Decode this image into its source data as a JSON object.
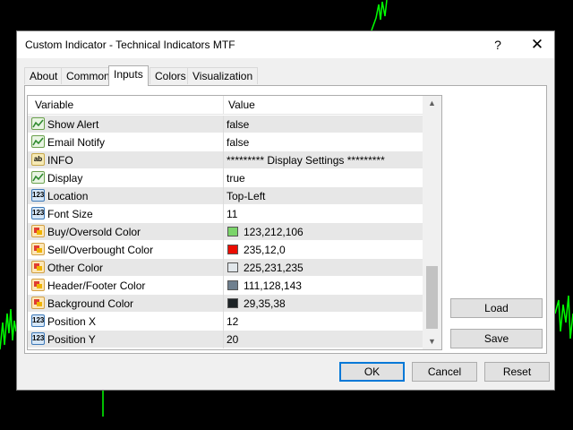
{
  "window": {
    "title": "Custom Indicator - Technical Indicators MTF",
    "help_glyph": "?",
    "close_glyph": "✕"
  },
  "tabs": [
    {
      "label": "About"
    },
    {
      "label": "Common"
    },
    {
      "label": "Inputs"
    },
    {
      "label": "Colors"
    },
    {
      "label": "Visualization"
    }
  ],
  "active_tab": "Inputs",
  "grid": {
    "col_variable": "Variable",
    "col_value": "Value",
    "rows": [
      {
        "icon": "bool-icon",
        "name": "Show Alert",
        "value": "false"
      },
      {
        "icon": "bool-icon",
        "name": "Email Notify",
        "value": "false"
      },
      {
        "icon": "string-icon",
        "icon_text": "ab",
        "name": "INFO",
        "value": "********* Display Settings *********"
      },
      {
        "icon": "bool-icon",
        "name": "Display",
        "value": "true"
      },
      {
        "icon": "integer-icon",
        "icon_text": "123",
        "name": "Location",
        "value": "Top-Left"
      },
      {
        "icon": "integer-icon",
        "icon_text": "123",
        "name": "Font Size",
        "value": "11"
      },
      {
        "icon": "color-icon",
        "name": "Buy/Oversold Color",
        "value": "123,212,106",
        "swatch": "#7bd46a"
      },
      {
        "icon": "color-icon",
        "name": "Sell/Overbought Color",
        "value": "235,12,0",
        "swatch": "#eb0c00"
      },
      {
        "icon": "color-icon",
        "name": "Other Color",
        "value": "225,231,235",
        "swatch": "#e1e7eb"
      },
      {
        "icon": "color-icon",
        "name": "Header/Footer Color",
        "value": "111,128,143",
        "swatch": "#6f808f"
      },
      {
        "icon": "color-icon",
        "name": "Background Color",
        "value": "29,35,38",
        "swatch": "#1d2326"
      },
      {
        "icon": "integer-icon",
        "icon_text": "123",
        "name": "Position X",
        "value": "12"
      },
      {
        "icon": "integer-icon",
        "icon_text": "123",
        "name": "Position Y",
        "value": "20"
      }
    ]
  },
  "side_buttons": {
    "load": "Load",
    "save": "Save"
  },
  "footer_buttons": {
    "ok": "OK",
    "cancel": "Cancel",
    "reset": "Reset"
  },
  "colors": {
    "accent": "#0078d7",
    "chart_line": "#00ff00",
    "background": "#000000"
  }
}
